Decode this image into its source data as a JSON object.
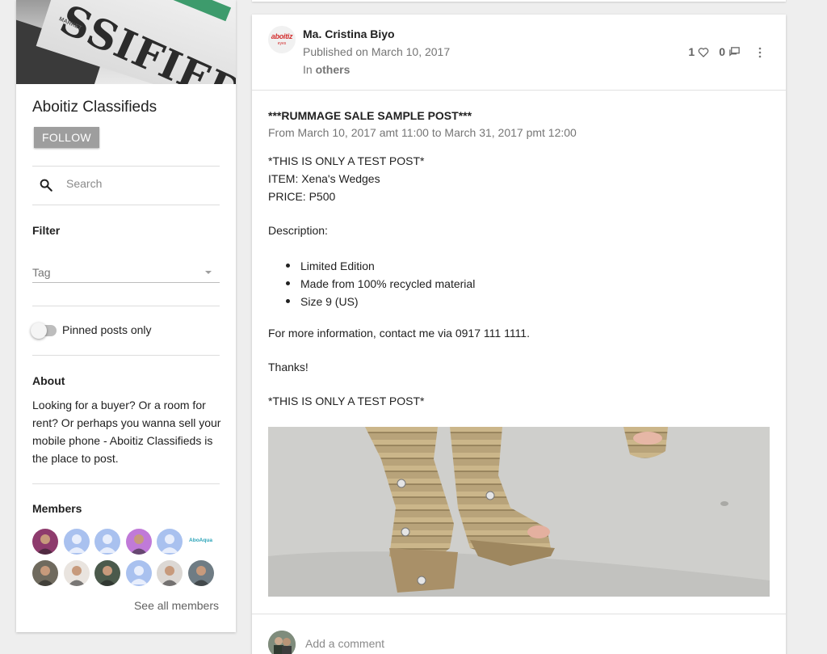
{
  "group": {
    "cover_word": "SSIFIEDS",
    "cover_small": "MARKET",
    "title": "Aboitiz Classifieds",
    "follow_label": "FOLLOW"
  },
  "search": {
    "placeholder": "Search"
  },
  "filter": {
    "heading": "Filter",
    "tag_label": "Tag",
    "pinned_label": "Pinned posts only",
    "pinned_on": false
  },
  "about": {
    "heading": "About",
    "text": "Looking for a buyer? Or a room for rent? Or perhaps you wanna sell your mobile phone - Aboitiz Classifieds is the place to post."
  },
  "members": {
    "heading": "Members",
    "see_all": "See all members",
    "logo_text": "AboAqua",
    "avatars": [
      {
        "type": "photo",
        "color": "#8e3b6d"
      },
      {
        "type": "default",
        "color": "#a9c1ef"
      },
      {
        "type": "default",
        "color": "#a9c1ef"
      },
      {
        "type": "photo",
        "color": "#c07ad8"
      },
      {
        "type": "default",
        "color": "#a9c1ef"
      },
      {
        "type": "logo",
        "color": "#ffffff"
      },
      {
        "type": "photo",
        "color": "#6f6a5e"
      },
      {
        "type": "photo",
        "color": "#e9e4df"
      },
      {
        "type": "photo",
        "color": "#4b5a4c"
      },
      {
        "type": "default",
        "color": "#a9c1ef"
      },
      {
        "type": "photo",
        "color": "#dcd8d4"
      },
      {
        "type": "photo",
        "color": "#6f7c84"
      }
    ]
  },
  "post": {
    "author_logo_main": "aboitiz",
    "author_logo_sub": "eyes",
    "author": "Ma. Cristina Biyo",
    "published": "Published on March 10, 2017",
    "in_prefix": "In ",
    "category": "others",
    "likes": "1",
    "comments": "0",
    "title": "***RUMMAGE SALE SAMPLE POST***",
    "dates": "From March 10, 2017 amt 11:00 to March 31, 2017 pmt 12:00",
    "line1": "*THIS IS ONLY A TEST POST*",
    "item": "ITEM: Xena's Wedges",
    "price": "PRICE: P500",
    "description_label": "Description:",
    "bullets": [
      "Limited Edition",
      "Made from 100% recycled material",
      "Size 9 (US)"
    ],
    "contact": "For more information, contact me via 0917 111 1111.",
    "thanks": "Thanks!",
    "closing": "*THIS IS ONLY A TEST POST*"
  },
  "comment": {
    "placeholder": "Add a comment"
  },
  "colors": {
    "background": "#eeeeee",
    "card": "#ffffff",
    "follow_button": "#9e9e9e",
    "muted_text": "#757575"
  }
}
